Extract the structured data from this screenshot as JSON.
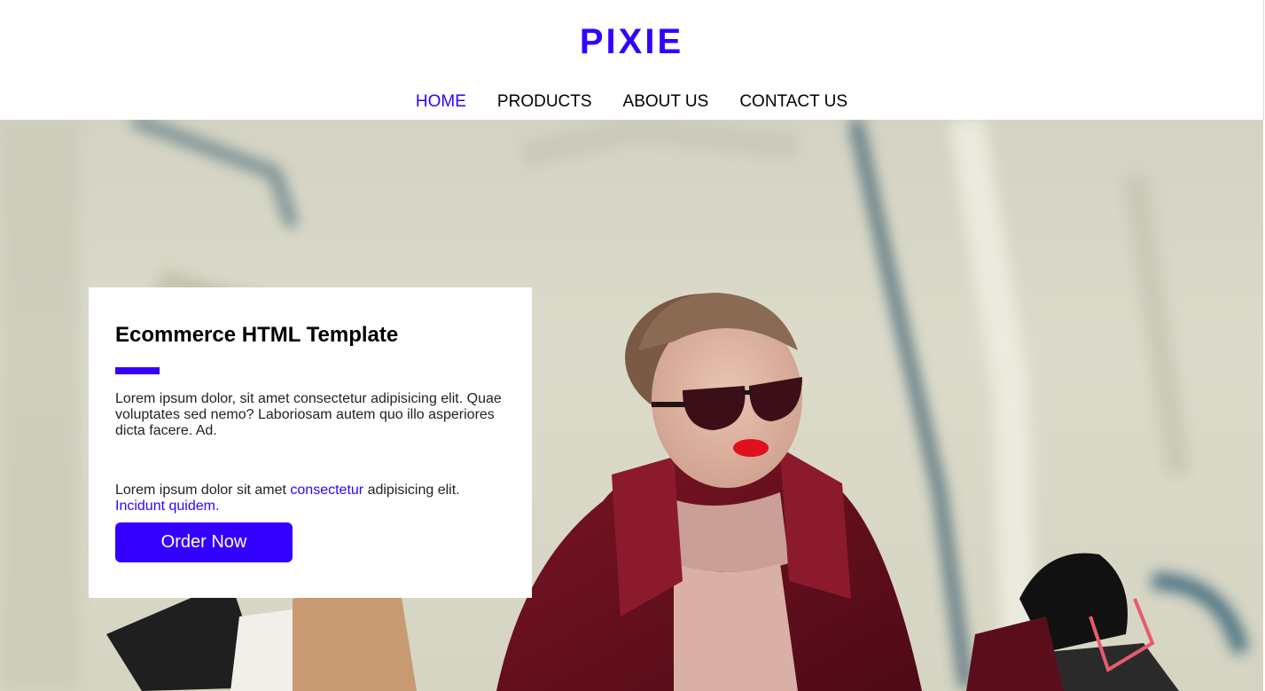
{
  "brand": {
    "name": "PIXIE",
    "color": "#3300ff"
  },
  "nav": {
    "items": [
      {
        "label": "HOME",
        "active": true
      },
      {
        "label": "PRODUCTS",
        "active": false
      },
      {
        "label": "ABOUT US",
        "active": false
      },
      {
        "label": "CONTACT US",
        "active": false
      }
    ]
  },
  "hero": {
    "image": "woman-with-sunglasses-and-shopping-bags",
    "card": {
      "title": "Ecommerce HTML Template",
      "paragraph1": "Lorem ipsum dolor, sit amet consectetur adipisicing elit. Quae voluptates sed nemo? Laboriosam autem quo illo asperiores dicta facere. Ad.",
      "paragraph2_start": "Lorem ipsum dolor sit amet ",
      "paragraph2_link1": "consectetur",
      "paragraph2_mid": " adipisicing elit.",
      "paragraph2_link2": "Incidunt quidem.",
      "button_label": "Order Now"
    }
  }
}
